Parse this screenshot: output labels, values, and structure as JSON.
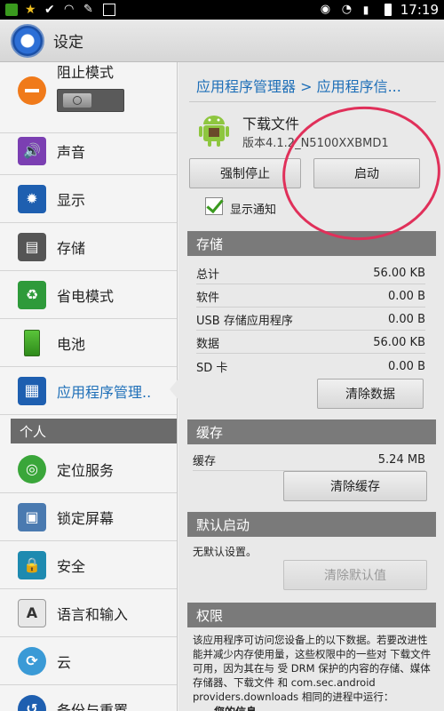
{
  "status_bar": {
    "time": "17:19"
  },
  "action_bar": {
    "title": "设定"
  },
  "left_menu": {
    "items_top": [
      {
        "label": "阻止模式"
      },
      {
        "label": "声音"
      },
      {
        "label": "显示"
      },
      {
        "label": "存储"
      },
      {
        "label": "省电模式"
      },
      {
        "label": "电池"
      },
      {
        "label": "应用程序管理.."
      }
    ],
    "section_personal": "个人",
    "items_personal": [
      {
        "label": "定位服务"
      },
      {
        "label": "锁定屏幕"
      },
      {
        "label": "安全"
      },
      {
        "label": "语言和输入"
      },
      {
        "label": "云"
      },
      {
        "label": "备份与重置"
      }
    ]
  },
  "detail": {
    "breadcrumb": "应用程序管理器 > 应用程序信...",
    "app_name": "下载文件",
    "app_version": "版本4.1.2_N5100XXBMD1",
    "force_stop_label": "强制停止",
    "start_label": "启动",
    "show_notification_label": "显示通知",
    "storage": {
      "header": "存储",
      "rows": [
        {
          "k": "总计",
          "v": "56.00 KB"
        },
        {
          "k": "软件",
          "v": "0.00 B"
        },
        {
          "k": "USB 存储应用程序",
          "v": "0.00 B"
        },
        {
          "k": "数据",
          "v": "56.00 KB"
        },
        {
          "k": "SD 卡",
          "v": "0.00 B"
        }
      ],
      "clear_data_label": "清除数据"
    },
    "cache": {
      "header": "缓存",
      "row": {
        "k": "缓存",
        "v": "5.24 MB"
      },
      "clear_cache_label": "清除缓存"
    },
    "defaults": {
      "header": "默认启动",
      "note": "无默认设置。",
      "clear_defaults_label": "清除默认值"
    },
    "permissions": {
      "header": "权限",
      "text": "该应用程序可访问您设备上的以下数据。若要改进性能并减少内存使用量，这些权限中的一些对 下载文件 可用，因为其在与 受 DRM 保护的内容的存储、媒体存储器、下载文件 和 com.sec.android providers.downloads 相同的进程中运行：",
      "sub": "您的信息"
    }
  }
}
